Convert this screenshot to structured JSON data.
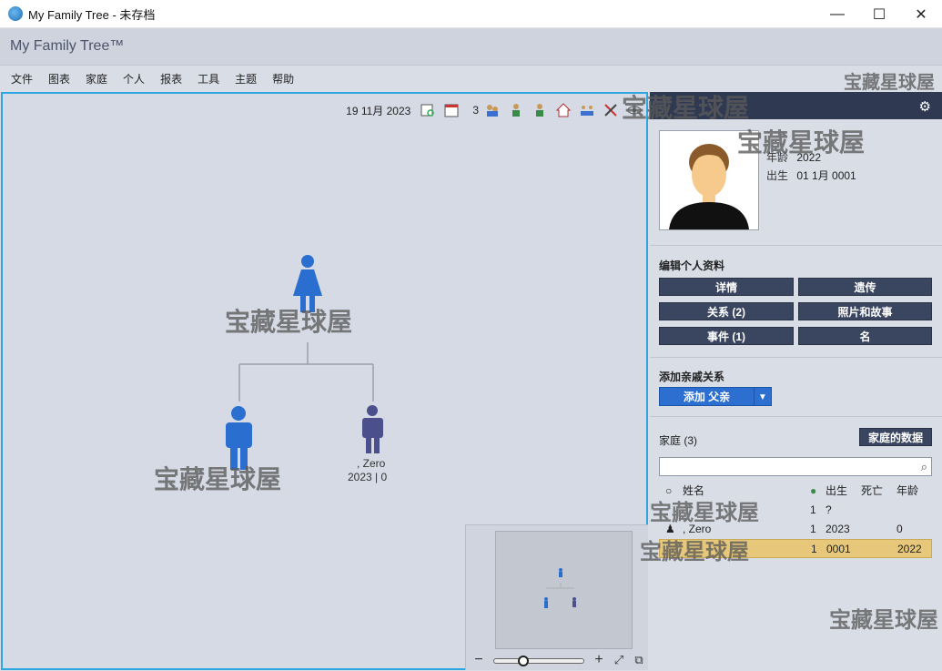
{
  "window": {
    "title": "My Family Tree - 未存档",
    "minimize": "—",
    "maximize": "☐",
    "close": "✕"
  },
  "app": {
    "name": "My Family Tree™"
  },
  "menu": [
    "文件",
    "图表",
    "家庭",
    "个人",
    "报表",
    "工具",
    "主题",
    "帮助"
  ],
  "toolbar": {
    "date": "19 11月 2023",
    "generations": "3"
  },
  "tree": {
    "people": [
      {
        "role": "mother",
        "gender": "female",
        "color": "#2a6fcf",
        "name": "",
        "dates": ""
      },
      {
        "role": "selected-person",
        "gender": "male",
        "color": "#2a6fcf",
        "name": "",
        "dates": ""
      },
      {
        "role": "sibling",
        "gender": "male",
        "color": "#4b4f8c",
        "name": ", Zero",
        "dates": "2023 | 0"
      }
    ]
  },
  "panel": {
    "profile": {
      "age_label": "年龄",
      "age": "2022",
      "birth_label": "出生",
      "birth": "01 1月 0001"
    },
    "edit_title": "编辑个人资料",
    "edit_buttons": [
      "详情",
      "遗传",
      "关系 (2)",
      "照片和故事",
      "事件 (1)",
      "名"
    ],
    "add_title": "添加亲戚关系",
    "add_button": "添加 父亲",
    "family_title": "家庭 (3)",
    "family_data_button": "家庭的数据",
    "search_placeholder": "",
    "table": {
      "headers": {
        "name": "姓名",
        "birth": "出生",
        "death": "死亡",
        "age": "年龄"
      },
      "rows": [
        {
          "name": "",
          "gen": "1",
          "birth": "?",
          "death": "",
          "age": "",
          "selected": false
        },
        {
          "name": ", Zero",
          "gen": "1",
          "birth": "2023",
          "death": "",
          "age": "0",
          "selected": false
        },
        {
          "name": "",
          "gen": "1",
          "birth": "0001",
          "death": "",
          "age": "2022",
          "selected": true
        }
      ]
    }
  },
  "minimap": {
    "zoom_level": 0.3
  },
  "watermark": "宝藏星球屋",
  "colors": {
    "accent": "#2ea6e0",
    "panel_head": "#2f3a52",
    "button": "#3a4560",
    "add_button": "#2c6fd0",
    "selected_row": "#e7c87a"
  }
}
